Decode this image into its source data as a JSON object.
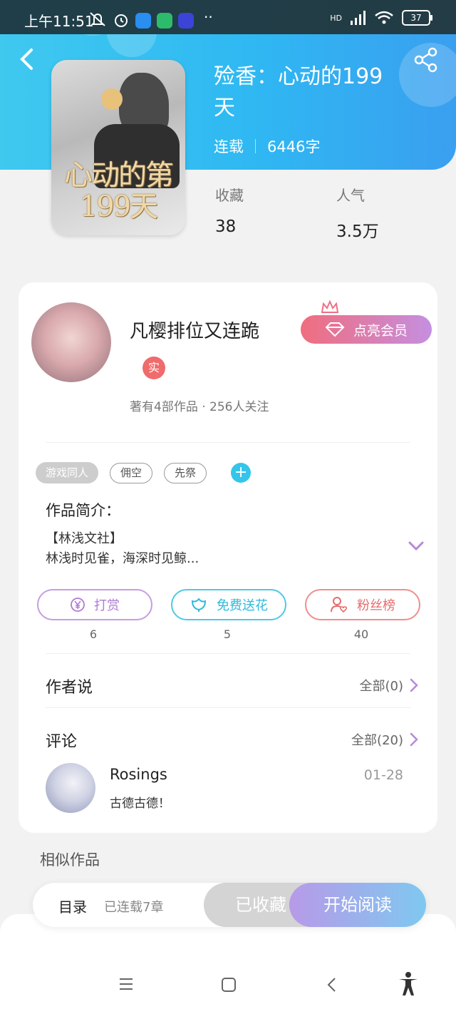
{
  "status_bar": {
    "time": "上午11:51",
    "battery": "37",
    "network_label": "HD"
  },
  "book": {
    "title": "殓香：心动的199天",
    "status": "连载",
    "word_count": "6446字",
    "cover_title": "心动的第199天",
    "stats": [
      {
        "label": "收藏",
        "value": "38"
      },
      {
        "label": "人气",
        "value": "3.5万"
      }
    ]
  },
  "author": {
    "name": "凡樱排位又连跪",
    "verified_badge": "实",
    "stats_text": "著有4部作品 · 256人关注",
    "vip_button": "点亮会员"
  },
  "tags": [
    "游戏同人",
    "佣空",
    "先祭"
  ],
  "intro": {
    "title": "作品简介：",
    "line1": "【林浅文社】",
    "line2": "林浅时见雀，海深时见鲸..."
  },
  "actions": [
    {
      "label": "打赏",
      "count": "6"
    },
    {
      "label": "免费送花",
      "count": "5"
    },
    {
      "label": "粉丝榜",
      "count": "40"
    }
  ],
  "author_says": {
    "title": "作者说",
    "link": "全部(0)"
  },
  "comments": {
    "title": "评论",
    "link": "全部(20)",
    "items": [
      {
        "user": "Rosings",
        "date": "01-28",
        "text": "古德古德！"
      }
    ]
  },
  "similar_title": "相似作品",
  "read_bar": {
    "toc": "目录",
    "chapters": "已连载7章",
    "collected": "已收藏",
    "start": "开始阅读"
  },
  "colors": {
    "header_accent": "#2fb8f2",
    "vip_gradient_start": "#f06d7e",
    "vip_gradient_end": "#c58fe0"
  }
}
